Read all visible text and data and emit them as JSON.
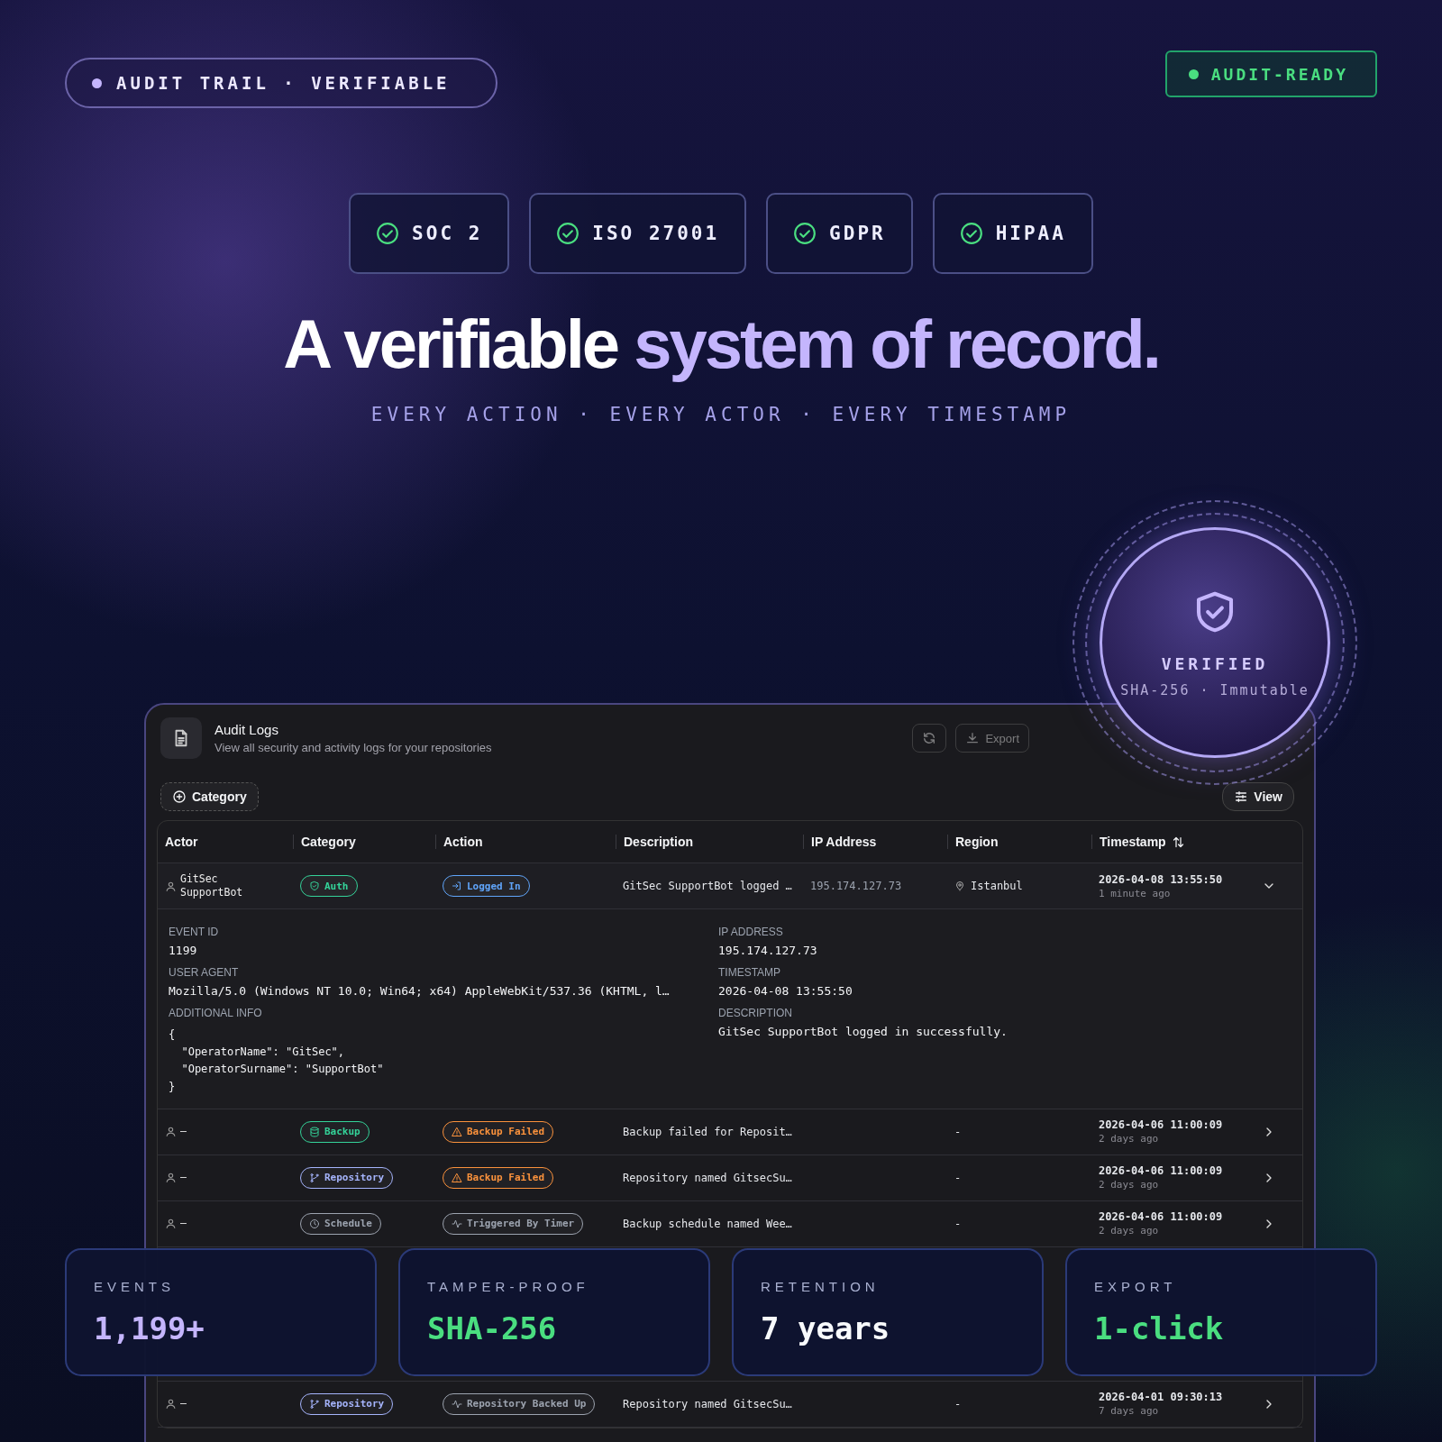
{
  "top_badge": {
    "label": "AUDIT TRAIL · VERIFIABLE"
  },
  "status_badge": {
    "label": "AUDIT-READY"
  },
  "certifications": [
    {
      "label": "SOC 2"
    },
    {
      "label": "ISO 27001"
    },
    {
      "label": "GDPR"
    },
    {
      "label": "HIPAA"
    }
  ],
  "headline": {
    "lead": "A verifiable",
    "accent": "system of record."
  },
  "subtitle": "EVERY ACTION · EVERY ACTOR · EVERY TIMESTAMP",
  "seal": {
    "title": "VERIFIED",
    "caption": "SHA-256 · Immutable"
  },
  "panel": {
    "title": "Audit Logs",
    "subtitle": "View all security and activity logs for your repositories",
    "export_button": "Export",
    "filter_button": "Category",
    "view_button": "View",
    "table": {
      "columns": [
        "Actor",
        "Category",
        "Action",
        "Description",
        "IP Address",
        "Region",
        "Timestamp"
      ],
      "rows": [
        {
          "actor": "GitSec SupportBot",
          "category": {
            "kind": "auth",
            "label": "Auth",
            "color": "#34d399"
          },
          "action": {
            "kind": "login",
            "label": "Logged In",
            "color": "#60a5fa"
          },
          "description": "GitSec SupportBot logged …",
          "ip": "195.174.127.73",
          "region": "Istanbul",
          "timestamp": "2026-04-08 13:55:50",
          "relative": "1 minute ago",
          "expanded": true,
          "details": {
            "event_id_label": "EVENT ID",
            "event_id": "1199",
            "user_agent_label": "USER AGENT",
            "user_agent": "Mozilla/5.0 (Windows NT 10.0; Win64; x64) AppleWebKit/537.36 (KHTML, l…",
            "info_label": "ADDITIONAL INFO",
            "info_lines": [
              "{",
              "  \"OperatorName\": \"GitSec\",",
              "  \"OperatorSurname\": \"SupportBot\"",
              "}"
            ],
            "ip_label": "IP ADDRESS",
            "ip": "195.174.127.73",
            "timestamp_label": "TIMESTAMP",
            "timestamp": "2026-04-08 13:55:50",
            "description_label": "DESCRIPTION",
            "description": "GitSec SupportBot logged in successfully."
          }
        },
        {
          "actor": "–",
          "category": {
            "kind": "backup",
            "label": "Backup",
            "color": "#34d399"
          },
          "action": {
            "kind": "warning",
            "label": "Backup Failed",
            "color": "#fb923c"
          },
          "description": "Backup failed for Reposit…",
          "region": "-",
          "timestamp": "2026-04-06 11:00:09",
          "relative": "2 days ago",
          "expanded": false
        },
        {
          "actor": "–",
          "category": {
            "kind": "repository",
            "label": "Repository",
            "color": "#a5b4fc"
          },
          "action": {
            "kind": "warning",
            "label": "Backup Failed",
            "color": "#fb923c"
          },
          "description": "Repository named GitsecSu…",
          "region": "-",
          "timestamp": "2026-04-06 11:00:09",
          "relative": "2 days ago",
          "expanded": false
        },
        {
          "actor": "–",
          "category": {
            "kind": "schedule",
            "label": "Schedule",
            "color": "#9ca3af"
          },
          "action": {
            "kind": "activity",
            "label": "Triggered By Timer",
            "color": "#9ca3af"
          },
          "description": "Backup schedule named Wee…",
          "region": "-",
          "timestamp": "2026-04-06 11:00:09",
          "relative": "2 days ago",
          "expanded": false
        },
        {
          "actor": "–",
          "category": {
            "kind": "repository",
            "label": "Repository",
            "color": "#a5b4fc"
          },
          "action": {
            "kind": "activity",
            "label": "Repository Backed Up",
            "color": "#9ca3af"
          },
          "description": "Repository named GitsecSu…",
          "region": "-",
          "timestamp": "2026-04-01 09:30:13",
          "relative": "7 days ago",
          "expanded": false
        }
      ]
    }
  },
  "stats": [
    {
      "label": "EVENTS",
      "value": "1,199+",
      "color": "#c4b5fd"
    },
    {
      "label": "TAMPER-PROOF",
      "value": "SHA-256",
      "color": "#4ade80"
    },
    {
      "label": "RETENTION",
      "value": "7 years",
      "color": "#f8fafc"
    },
    {
      "label": "EXPORT",
      "value": "1-click",
      "color": "#4ade80"
    }
  ]
}
